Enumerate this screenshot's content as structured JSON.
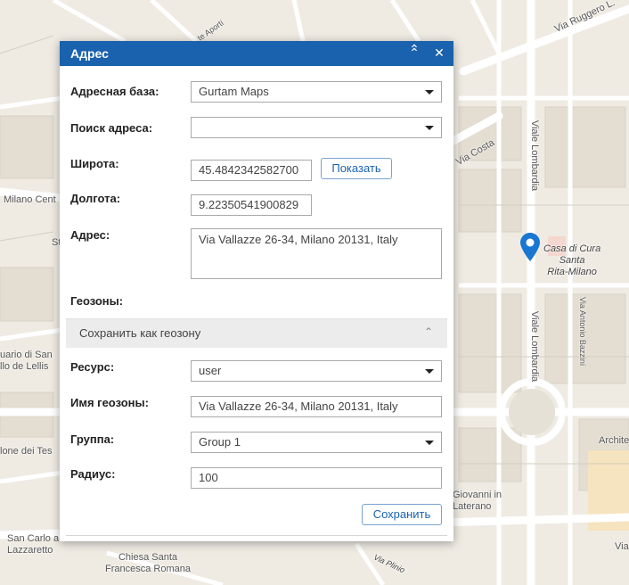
{
  "map": {
    "labels": [
      {
        "name": "map-label-via-ruggero",
        "text": "Via Ruggero L."
      },
      {
        "name": "map-label-viale-lombardia-1",
        "text": "Viale Lombardia"
      },
      {
        "name": "map-label-via-costa",
        "text": "Via Costa"
      },
      {
        "name": "map-label-milano-centrale",
        "text": "Milano Cent"
      },
      {
        "name": "map-label-st",
        "text": "St"
      },
      {
        "name": "map-label-casa-di-cura",
        "text": "Casa di Cura\nSanta\nRita-Milano"
      },
      {
        "name": "map-label-viale-lombardia-2",
        "text": "Viale Lombardia"
      },
      {
        "name": "map-label-via-antonio-bazzini",
        "text": "Via Antonio Bazzini"
      },
      {
        "name": "map-label-santuario",
        "text": "uario di San\nllo de Lellis"
      },
      {
        "name": "map-label-architettura",
        "text": "Archite"
      },
      {
        "name": "map-label-lone-dei-tes",
        "text": "lone dei Tes"
      },
      {
        "name": "map-label-giovanni-in-laterano",
        "text": "Giovanni in\nLaterano"
      },
      {
        "name": "map-label-san-carlo",
        "text": "San Carlo a\nLazzaretto"
      },
      {
        "name": "map-label-chiesa-santa",
        "text": "Chiesa Santa\nFrancesca Romana"
      },
      {
        "name": "map-label-via-pinio",
        "text": "Via Plinio"
      },
      {
        "name": "map-label-via-right",
        "text": "Via"
      },
      {
        "name": "map-label-aporti",
        "text": "te Aporti"
      }
    ],
    "marker_color": "#1976d2"
  },
  "dialog": {
    "title": "Адрес",
    "collapse_icon": "double-chevron-up-icon",
    "close_icon": "close-icon",
    "address_base": {
      "label": "Адресная база:",
      "value": "Gurtam Maps"
    },
    "address_search": {
      "label": "Поиск адреса:",
      "value": ""
    },
    "latitude": {
      "label": "Широта:",
      "value": "45.4842342582700"
    },
    "show_button": "Показать",
    "longitude": {
      "label": "Долгота:",
      "value": "9.22350541900829"
    },
    "address": {
      "label": "Адрес:",
      "value": "Via Vallazze 26-34, Milano 20131, Italy"
    },
    "geozones": {
      "label": "Геозоны:"
    },
    "save_as_geozone": {
      "label": "Сохранить как геозону",
      "chevron_icon": "chevron-up-icon"
    },
    "resource": {
      "label": "Ресурс:",
      "value": "user"
    },
    "geozone_name": {
      "label": "Имя геозоны:",
      "value": "Via Vallazze 26-34, Milano 20131, Italy"
    },
    "group": {
      "label": "Группа:",
      "value": "Group 1"
    },
    "radius": {
      "label": "Радиус:",
      "value": "100"
    },
    "save_button": "Сохранить",
    "accent_color": "#1a62ad"
  }
}
